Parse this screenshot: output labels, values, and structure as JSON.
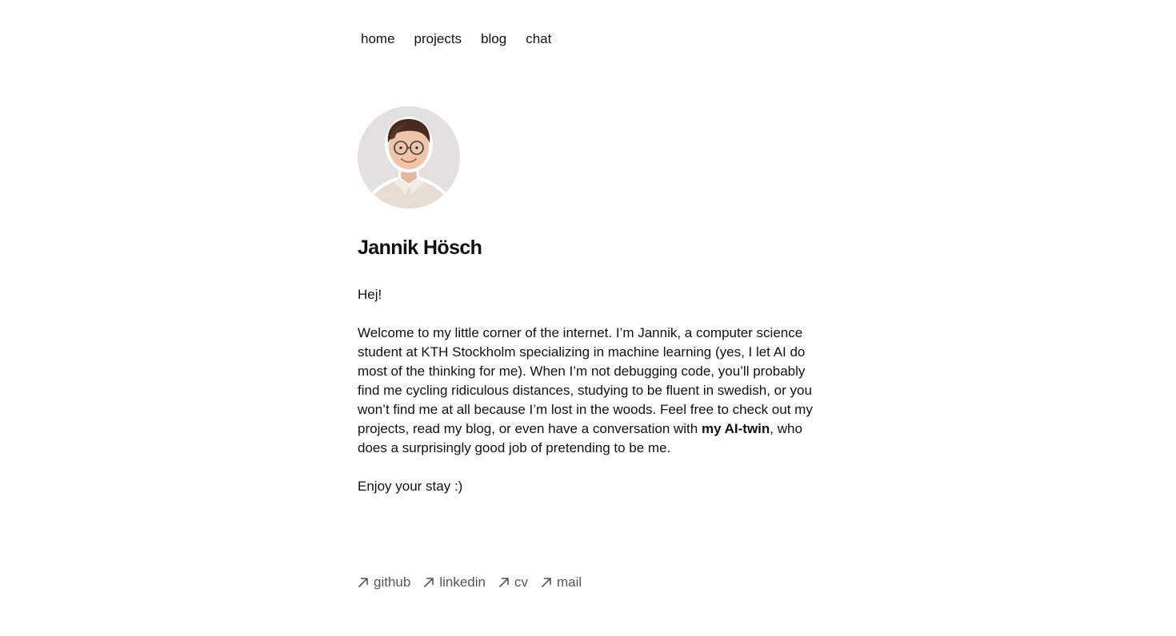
{
  "nav": {
    "items": [
      {
        "label": "home"
      },
      {
        "label": "projects"
      },
      {
        "label": "blog"
      },
      {
        "label": "chat"
      }
    ]
  },
  "profile": {
    "avatar_icon": "person-portrait",
    "name": "Jannik Hösch"
  },
  "intro": {
    "greeting": "Hej!",
    "paragraph_before_bold": "Welcome to my little corner of the internet. I’m Jannik, a computer science student at KTH Stockholm specializing in machine learning (yes, I let AI do most of the thinking for me). When I’m not debugging code, you’ll probably find me cycling ridiculous distances, studying to be fluent in swedish, or you won’t find me at all because I’m lost in the woods. Feel free to check out my projects, read my blog, or even have a conversation with ",
    "bold_link": "my AI-twin",
    "paragraph_after_bold": ", who does a surprisingly good job of pretending to be me.",
    "closing": "Enjoy your stay :)"
  },
  "links": {
    "icon": "arrow-up-right-icon",
    "items": [
      {
        "label": "github"
      },
      {
        "label": "linkedin"
      },
      {
        "label": "cv"
      },
      {
        "label": "mail"
      }
    ]
  },
  "colors": {
    "text": "#111111",
    "muted_link": "#555555",
    "avatar_bg": "#e2e0e1"
  }
}
